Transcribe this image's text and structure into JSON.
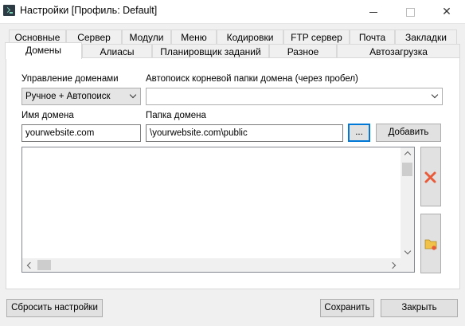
{
  "window": {
    "title": "Настройки [Профиль: Default]",
    "controls": {
      "minimize": "minimize",
      "maximize": "maximize",
      "close": "✕"
    }
  },
  "tabs_row1": [
    "Основные",
    "Сервер",
    "Модули",
    "Меню",
    "Кодировки",
    "FTP сервер",
    "Почта",
    "Закладки"
  ],
  "tabs_row2": [
    "Домены",
    "Алиасы",
    "Планировщик заданий",
    "Разное",
    "Автозагрузка"
  ],
  "active_tab": "Домены",
  "domains": {
    "management_label": "Управление доменами",
    "management_value": "Ручное + Автопоиск",
    "autosearch_label": "Автопоиск корневой папки домена (через пробел)",
    "autosearch_value": "",
    "domain_name_label": "Имя домена",
    "domain_name_value": "yourwebsite.com",
    "domain_folder_label": "Папка домена",
    "domain_folder_value": "\\yourwebsite.com\\public",
    "browse_label": "...",
    "add_label": "Добавить",
    "list_items": []
  },
  "footer": {
    "reset_label": "Сбросить настройки",
    "save_label": "Сохранить",
    "close_label": "Закрыть"
  },
  "colors": {
    "delete_icon": "#e85b3a",
    "folder_icon": "#f0c24a",
    "focus_border": "#0078d7"
  }
}
